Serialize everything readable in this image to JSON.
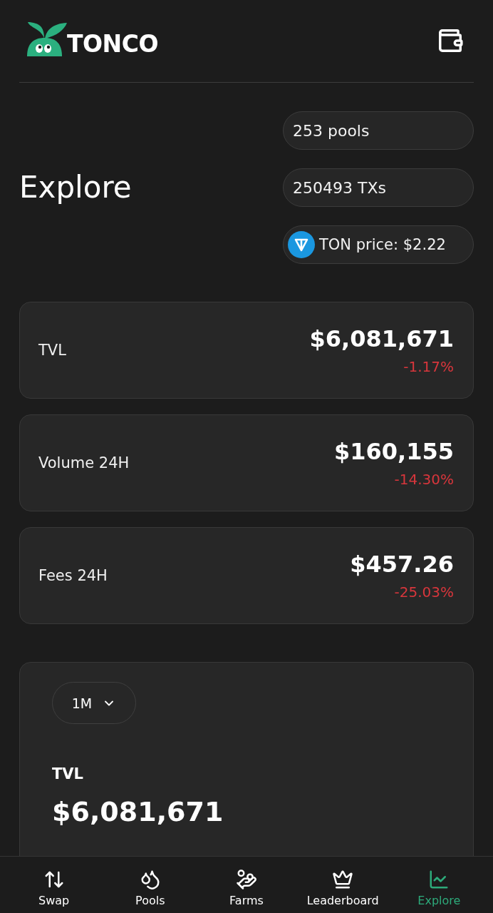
{
  "header": {
    "logo_text": "TONCO"
  },
  "page": {
    "title": "Explore"
  },
  "summary_pills": [
    {
      "kind": "text",
      "label": "253 pools"
    },
    {
      "kind": "text",
      "label": "250493 TXs"
    },
    {
      "kind": "price",
      "label": "TON price: $2.22"
    }
  ],
  "stats": [
    {
      "label": "TVL",
      "value": "$6,081,671",
      "change": "-1.17%",
      "negative": true
    },
    {
      "label": "Volume 24H",
      "value": "$160,155",
      "change": "-14.30%",
      "negative": true
    },
    {
      "label": "Fees 24H",
      "value": "$457.26",
      "change": "-25.03%",
      "negative": true
    }
  ],
  "chart_card": {
    "period": "1M",
    "metric": "TVL",
    "value": "$6,081,671"
  },
  "bottom_nav": [
    {
      "label": "Swap",
      "selected": false
    },
    {
      "label": "Pools",
      "selected": false
    },
    {
      "label": "Farms",
      "selected": false
    },
    {
      "label": "Leaderboard",
      "selected": false
    },
    {
      "label": "Explore",
      "selected": true
    }
  ]
}
